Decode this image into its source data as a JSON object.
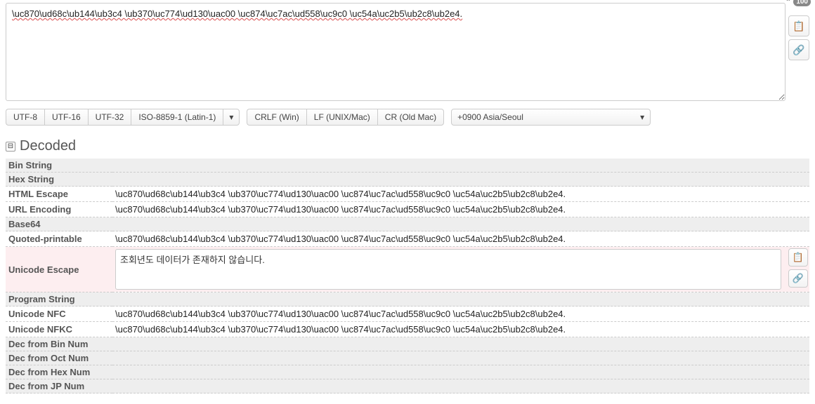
{
  "input": {
    "text": "\\uc870\\ud68c\\ub144\\ub3c4 \\ub370\\uc774\\ud130\\uac00 \\uc874\\uc7ac\\ud558\\uc9c0 \\uc54a\\uc2b5\\ub2c8\\ub2e4.",
    "badge": "100"
  },
  "encoding_buttons": {
    "utf8": "UTF-8",
    "utf16": "UTF-16",
    "utf32": "UTF-32",
    "iso": "ISO-8859-1 (Latin-1)",
    "caret": "▾"
  },
  "lineend_buttons": {
    "crlf": "CRLF (Win)",
    "lf": "LF (UNIX/Mac)",
    "cr": "CR (Old Mac)"
  },
  "timezone": {
    "selected": "+0900 Asia/Seoul",
    "caret": "▾"
  },
  "section": {
    "title": "Decoded",
    "collapse_glyph": "⊟"
  },
  "rows": {
    "bin_string": {
      "label": "Bin String",
      "value": ""
    },
    "hex_string": {
      "label": "Hex String",
      "value": ""
    },
    "html_escape": {
      "label": "HTML Escape",
      "value": "\\uc870\\ud68c\\ub144\\ub3c4 \\ub370\\uc774\\ud130\\uac00 \\uc874\\uc7ac\\ud558\\uc9c0 \\uc54a\\uc2b5\\ub2c8\\ub2e4."
    },
    "url_encoding": {
      "label": "URL Encoding",
      "value": "\\uc870\\ud68c\\ub144\\ub3c4 \\ub370\\uc774\\ud130\\uac00 \\uc874\\uc7ac\\ud558\\uc9c0 \\uc54a\\uc2b5\\ub2c8\\ub2e4."
    },
    "base64": {
      "label": "Base64",
      "value": ""
    },
    "quoted_printable": {
      "label": "Quoted-printable",
      "value": "\\uc870\\ud68c\\ub144\\ub3c4 \\ub370\\uc774\\ud130\\uac00 \\uc874\\uc7ac\\ud558\\uc9c0 \\uc54a\\uc2b5\\ub2c8\\ub2e4."
    },
    "unicode_escape": {
      "label": "Unicode Escape",
      "value": "조회년도 데이터가 존재하지 않습니다."
    },
    "program_string": {
      "label": "Program String",
      "value": ""
    },
    "unicode_nfc": {
      "label": "Unicode NFC",
      "value": "\\uc870\\ud68c\\ub144\\ub3c4 \\ub370\\uc774\\ud130\\uac00 \\uc874\\uc7ac\\ud558\\uc9c0 \\uc54a\\uc2b5\\ub2c8\\ub2e4."
    },
    "unicode_nfkc": {
      "label": "Unicode NFKC",
      "value": "\\uc870\\ud68c\\ub144\\ub3c4 \\ub370\\uc774\\ud130\\uac00 \\uc874\\uc7ac\\ud558\\uc9c0 \\uc54a\\uc2b5\\ub2c8\\ub2e4."
    },
    "dec_bin": {
      "label": "Dec from Bin Num",
      "value": ""
    },
    "dec_oct": {
      "label": "Dec from Oct Num",
      "value": ""
    },
    "dec_hex": {
      "label": "Dec from Hex Num",
      "value": ""
    },
    "dec_jp": {
      "label": "Dec from JP Num",
      "value": ""
    }
  }
}
